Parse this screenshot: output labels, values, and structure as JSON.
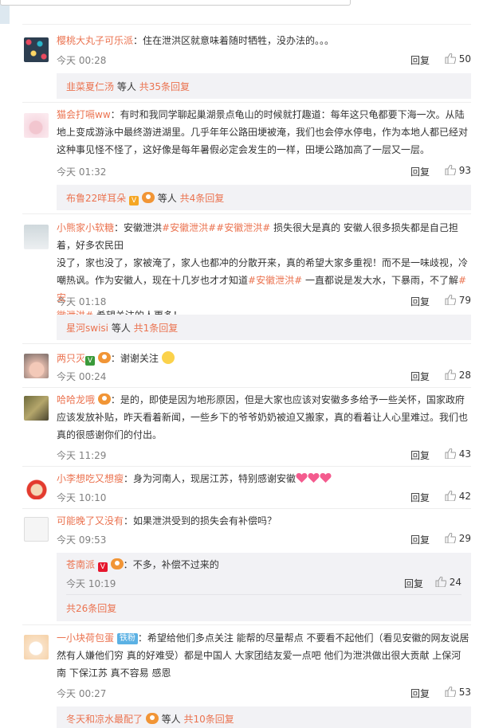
{
  "top": {
    "prev_text": "等人 共 条回复"
  },
  "comments": [
    {
      "user": "樱桃大丸子可乐派",
      "text": "住在泄洪区就意味着随时牺牲，没办法的。。。",
      "time": "今天 00:28",
      "reply": "回复",
      "likes": "50",
      "thread": {
        "users": "韭菜夏仁汤",
        "suffix": "等人",
        "count": "共35条回复"
      }
    },
    {
      "user": "猫会打嗝ww",
      "text1": "有时和我同学聊起巢湖景点龟山的时候就打趣道：每年这只龟都要下海一次。从陆",
      "text2": "地上变成游泳中最终游进湖里。几乎年年公路田埂被淹，我们也会停水停电，作为本地人都已经对",
      "text3": "这种事见怪不怪了，这好像是每年暑假必定会发生的一样，田埂公路加高了一层又一层。",
      "time": "今天 01:32",
      "reply": "回复",
      "likes": "93",
      "thread": {
        "users": "布鲁22咩耳朵",
        "suffix": "等人",
        "count": "共4条回复"
      }
    },
    {
      "user": "小熊家小软糖",
      "tag1": "#安徽泄洪#",
      "tag2": "#安徽泄洪#",
      "text1a": "损失很大是真的 安徽人很多损失都是自己担着，好多农民田",
      "text2": "没了，家也没了，家被淹了，家人也都冲的分散开来，真的希望大家多重视！而不是一味歧视，冷",
      "text3a": "嘲热讽。作为安徽人，现在十几岁也才才知道",
      "tag3": "#安徽泄洪#",
      "text3b": "一直都说是发大水，下暴雨，不了解",
      "tag4a": "#安",
      "tag4b": "徽泄洪#",
      "text4": "希望关注的人更多！",
      "time": "今天 01:18",
      "reply": "回复",
      "likes": "79",
      "thread": {
        "users": "星河swisi",
        "suffix": "等人",
        "count": "共1条回复"
      }
    },
    {
      "user": "两只灭",
      "text": "谢谢关注",
      "time": "今天 00:24",
      "reply": "回复",
      "likes": "28"
    },
    {
      "user": "哈哈龙哦",
      "text1": "是的，即使是因为地形原因，但是大家也应该对安徽多多给予一些关怀，国家政府",
      "text2": "应该发放补贴，昨天看着新闻，一些乡下的爷爷奶奶被迫又搬家，真的看着让人心里难过。我们也",
      "text3": "真的很感谢你们的付出。",
      "time": "今天 11:29",
      "reply": "回复",
      "likes": "43"
    },
    {
      "user": "小李想吃又想瘦",
      "text": "身为河南人，现居江苏，特别感谢安徽",
      "time": "今天 10:10",
      "reply": "回复",
      "likes": "42"
    },
    {
      "user": "可能晚了又没有",
      "text": "如果泄洪受到的损失会有补偿吗？",
      "time": "今天 09:53",
      "reply": "回复",
      "likes": "29",
      "subreply": {
        "user": "苍南派",
        "text": "不多，补偿不过来的",
        "time": "今天 10:19",
        "reply": "回复",
        "likes": "24",
        "more": "共26条回复"
      }
    },
    {
      "user": "一小块荷包蛋",
      "badge": "铁粉",
      "text1": "希望给他们多点关注 能帮的尽量帮点  不要看不起他们（看见安徽的网友说居",
      "text2": "然有人嫌他们穷  真的好难受）都是中国人   大家团结友爱一点吧  他们为泄洪做出很大贡献  上保河",
      "text3": "南 下保江苏  真不容易 感恩",
      "time": "今天 00:27",
      "reply": "回复",
      "likes": "53",
      "thread": {
        "users": "冬天和凉水最配了",
        "suffix": "等人",
        "count": "共10条回复"
      }
    }
  ],
  "colors": {
    "accent": "#eb7350",
    "subbg": "#f2f2f5",
    "meta": "#808080"
  },
  "icons": {
    "like": "thumbs-up-icon",
    "vip": "v-badge-icon",
    "fan": "fan-badge-icon"
  }
}
